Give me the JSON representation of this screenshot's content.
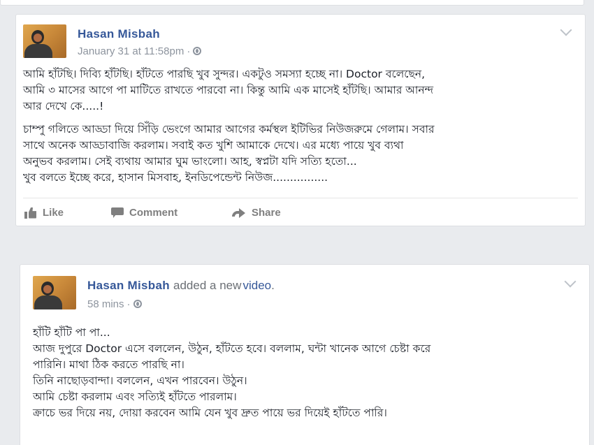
{
  "posts": [
    {
      "author": "Hasan Misbah",
      "action": "",
      "action_link": "",
      "timestamp": "January 31 at 11:58pm",
      "privacy_icon": "globe-icon",
      "paragraphs": [
        [
          "আমি হাঁটছি। দিব্যি হাঁটছি। হাঁটতে পারছি খুব সুন্দর। একটুও সমস্যা হচ্ছে না। Doctor বলেছেন,",
          "আমি ৩ মাসের আগে পা মাটিতে রাখতে পারবো না। কিন্তু আমি এক মাসেই হাঁটছি। আমার আনন্দ",
          "আর দেখে কে.....!"
        ],
        [
          "চাম্পু গলিতে আড্ডা দিয়ে সিঁড়ি ভেংগে আমার আগের কর্মস্থল ইটিভির নিউজরুমে গেলাম। সবার",
          "সাথে অনেক আড্ডাবাজি করলাম। সবাই কত খুশি আমাকে দেখে। এর মধ্যে পায়ে খুব ব্যথা",
          "অনুভব করলাম। সেই ব্যথায় আমার ঘুম ভাংলো। আহ, স্বপ্নটা যদি সত্যি হতো...",
          "খুব বলতে ইচ্ছে করে, হাসান মিসবাহ, ইনডিপেন্ডেন্ট নিউজ................"
        ]
      ],
      "actions": {
        "like": "Like",
        "comment": "Comment",
        "share": "Share"
      }
    },
    {
      "author": "Hasan Misbah",
      "action": "added a new",
      "action_link": "video",
      "action_suffix": ".",
      "timestamp": "58 mins",
      "privacy_icon": "globe-icon",
      "paragraphs": [
        [
          "হাঁটি হাঁটি পা পা...",
          "আজ দুপুরে Doctor এসে বললেন, উঠুন, হাঁটতে হবে। বললাম, ঘন্টা খানেক আগে চেষ্টা করে",
          "পারিনি। মাথা ঠিক করতে পারছি না।",
          "তিনি নাছোড়বান্দা। বললেন, এখন পারবেন। উঠুন।",
          "আমি চেষ্টা করলাম এবং সত্যিই হাঁটতে পারলাম।",
          "ক্রাচে ভর দিয়ে নয়, দোয়া করবেন আমি যেন খুব দ্রুত পায়ে ভর দিয়েই হাঁটতে পারি।"
        ]
      ]
    }
  ],
  "colors": {
    "author_link": "#365899",
    "meta_gray": "#8d949e",
    "body_text": "#1d2129",
    "action_gray": "#7f7f7f",
    "page_bg": "#e9ebee"
  }
}
